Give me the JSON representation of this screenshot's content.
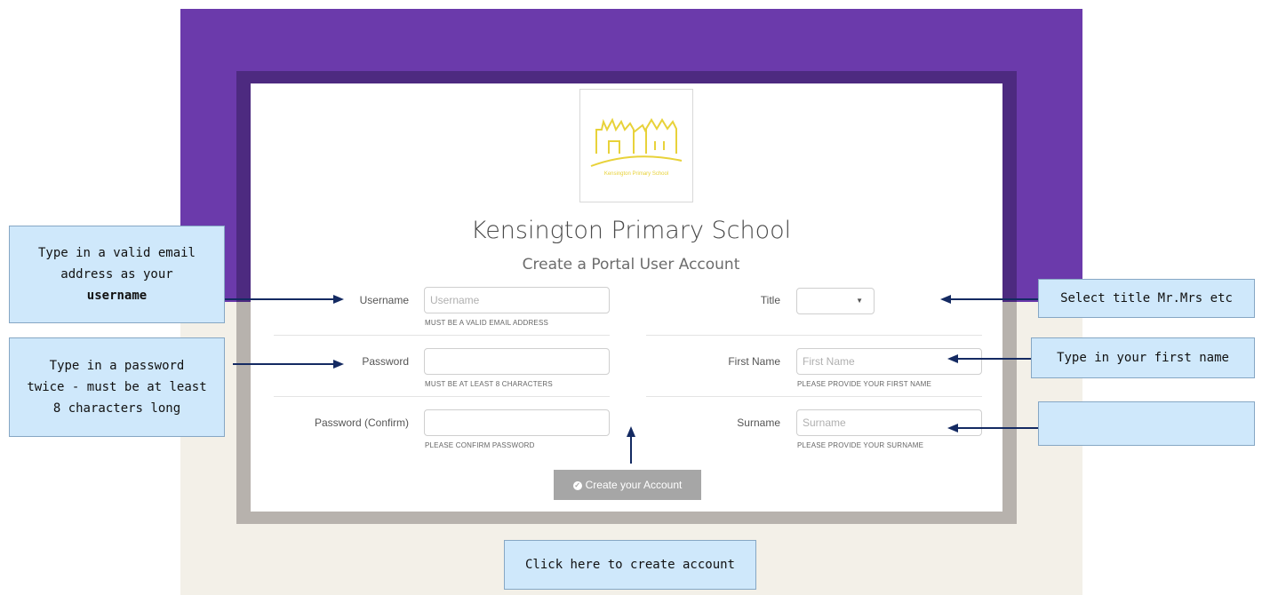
{
  "school": {
    "name": "Kensington Primary School",
    "subtitle": "Create a Portal User Account",
    "logo_caption": "Kensington Primary School",
    "logo_color": "#e8d23a"
  },
  "form": {
    "username": {
      "label": "Username",
      "placeholder": "Username",
      "help": "MUST BE A VALID EMAIL ADDRESS"
    },
    "password": {
      "label": "Password",
      "placeholder": "",
      "help": "MUST BE AT LEAST 8 CHARACTERS"
    },
    "password_confirm": {
      "label": "Password (Confirm)",
      "placeholder": "",
      "help": "PLEASE CONFIRM PASSWORD"
    },
    "title": {
      "label": "Title",
      "value": ""
    },
    "first_name": {
      "label": "First Name",
      "placeholder": "First Name",
      "help": "PLEASE PROVIDE YOUR FIRST NAME"
    },
    "surname": {
      "label": "Surname",
      "placeholder": "Surname",
      "help": "PLEASE PROVIDE YOUR SURNAME"
    },
    "submit_label": "Create your Account"
  },
  "callouts": {
    "username_line1": "Type in a valid email",
    "username_line2": "address as your",
    "username_line3": "username",
    "password_line1": "Type in a password",
    "password_line2": "twice - must be at least",
    "password_line3": "8 characters long",
    "title": "Select title Mr.Mrs etc",
    "first_name": "Type in your first name",
    "surname": "",
    "create": "Click here to create account"
  },
  "colors": {
    "purple": "#6b3aab",
    "dark_purple": "#4d2a80",
    "cream": "#f3f0e8",
    "callout_bg": "#cfe8fb",
    "arrow": "#142a62"
  }
}
